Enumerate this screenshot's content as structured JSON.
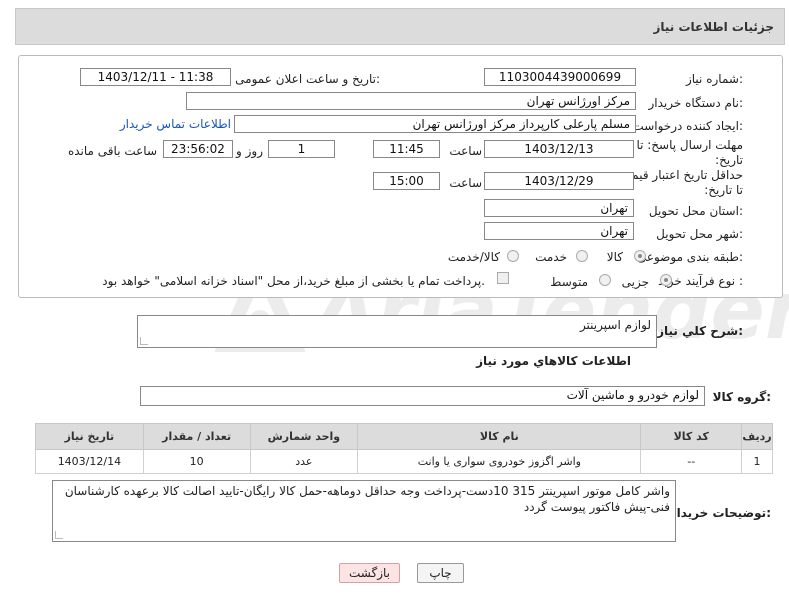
{
  "header": {
    "title": "جزئیات اطلاعات نیاز"
  },
  "form": {
    "need_number_label": "شماره نیاز:",
    "need_number": "1103004439000699",
    "announce_label": "تاریخ و ساعت اعلان عمومی:",
    "announce_value": "1403/12/11 - 11:38",
    "buyer_org_label": "نام دستگاه خریدار:",
    "buyer_org": "مرکز اورژانس تهران",
    "requester_label": "ایجاد کننده درخواست:",
    "requester": "مسلم پارعلی کارپرداز مرکز اورژانس تهران",
    "contact_link": "اطلاعات تماس خریدار",
    "deadline_label": "مهلت ارسال پاسخ: تا تاریخ:",
    "deadline_date": "1403/12/13",
    "time_label": "ساعت",
    "deadline_time": "11:45",
    "days_value": "1",
    "days_label": "روز و",
    "remaining_time": "23:56:02",
    "remaining_label": "ساعت باقی مانده",
    "validity_label": "حداقل تاریخ اعتبار قیمت: تا تاریخ:",
    "validity_date": "1403/12/29",
    "validity_time": "15:00",
    "province_label": "استان محل تحویل:",
    "province": "تهران",
    "city_label": "شهر محل تحویل:",
    "city": "تهران",
    "category_label": "طبقه بندی موضوعی:",
    "category_options": [
      "کالا",
      "خدمت",
      "کالا/خدمت"
    ],
    "process_label": "نوع فرآیند خرید :",
    "process_options": [
      "جزیی",
      "متوسط"
    ],
    "payment_note": "پرداخت تمام یا بخشی از مبلغ خرید،از محل \"اسناد خزانه اسلامی\" خواهد بود."
  },
  "summary": {
    "label": "شرح کلي نياز:",
    "value": "لوازم اسپرینتر"
  },
  "goods_info_title": "اطلاعات کالاهاي مورد نياز",
  "goods_group": {
    "label": "گروه کالا:",
    "value": "لوازم خودرو و ماشین آلات"
  },
  "table": {
    "headers": [
      "رديف",
      "کد کالا",
      "نام کالا",
      "واحد شمارش",
      "تعداد / مقدار",
      "تاريخ نياز"
    ],
    "rows": [
      [
        "1",
        "--",
        "واشر اگزوز خودروی سواری یا وانت",
        "عدد",
        "10",
        "1403/12/14"
      ]
    ]
  },
  "buyer_notes": {
    "label": "توضیحات خریدار:",
    "value": "واشر کامل موتور اسپرینتر 315   10دست-پرداخت وجه حداقل دوماهه-حمل کالا رایگان-تایید اصالت کالا برعهده کارشناسان فنی-پیش فاکتور پیوست گردد"
  },
  "buttons": {
    "print": "چاپ",
    "back": "بازگشت"
  },
  "colors": {
    "header_bg": "#dcdcdc",
    "link": "#1a55b5",
    "back_button_bg": "#fbe4e4",
    "watermark": "#ececec"
  },
  "watermark": {
    "text": "AriaTender.net"
  }
}
